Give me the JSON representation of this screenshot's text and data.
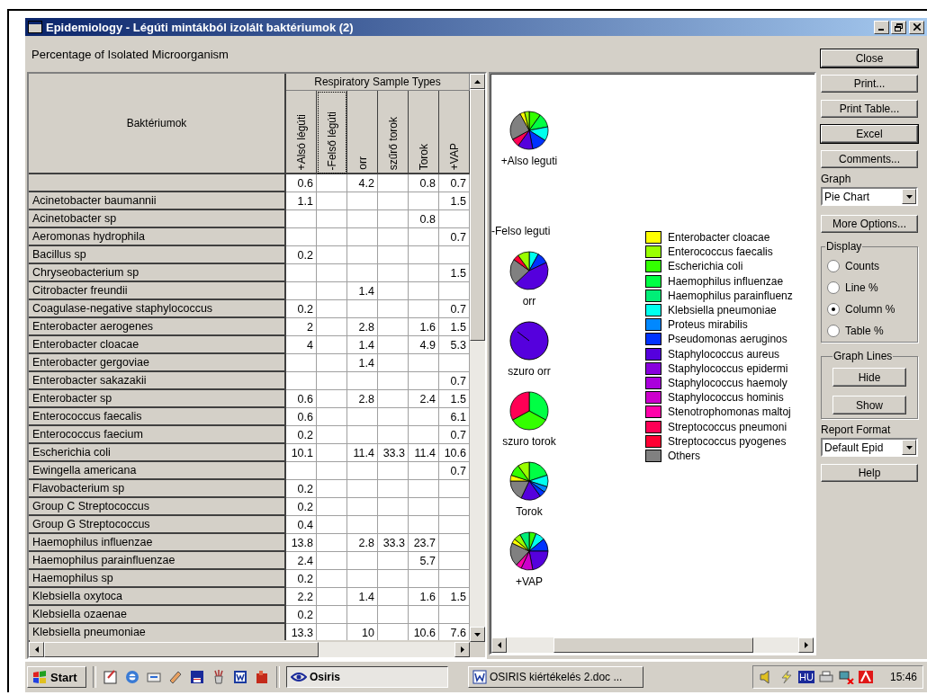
{
  "window": {
    "title": "Epidemiology - Légúti mintákból izolált baktériumok (2)",
    "subtitle": "Percentage of Isolated Microorganism"
  },
  "table": {
    "row_header": "Baktériumok",
    "group_header": "Respiratory Sample Types",
    "columns": [
      {
        "label": "+Alsó légúti",
        "focused": false
      },
      {
        "label": "-Felső légúti",
        "focused": true
      },
      {
        "label": "orr",
        "focused": false
      },
      {
        "label": "szűrő torok",
        "focused": false
      },
      {
        "label": "Torok",
        "focused": false
      },
      {
        "label": "+VAP",
        "focused": false
      }
    ],
    "rows": [
      {
        "col_1": "0.6",
        "col_3": "4.2",
        "col_5": "0.8",
        "col_6": "0.7"
      },
      {
        "name": "Acinetobacter baumannii",
        "col_1": "1.1",
        "col_6": "1.5"
      },
      {
        "name": "Acinetobacter sp",
        "col_5": "0.8"
      },
      {
        "name": "Aeromonas hydrophila",
        "col_6": "0.7"
      },
      {
        "name": "Bacillus sp",
        "col_1": "0.2"
      },
      {
        "name": "Chryseobacterium sp",
        "col_6": "1.5"
      },
      {
        "name": "Citrobacter freundii",
        "col_3": "1.4"
      },
      {
        "name": "Coagulase-negative staphylococcus",
        "col_1": "0.2",
        "col_6": "0.7"
      },
      {
        "name": "Enterobacter aerogenes",
        "col_1": "2",
        "col_3": "2.8",
        "col_5": "1.6",
        "col_6": "1.5"
      },
      {
        "name": "Enterobacter cloacae",
        "col_1": "4",
        "col_3": "1.4",
        "col_5": "4.9",
        "col_6": "5.3"
      },
      {
        "name": "Enterobacter gergoviae",
        "col_3": "1.4"
      },
      {
        "name": "Enterobacter sakazakii",
        "col_6": "0.7"
      },
      {
        "name": "Enterobacter sp",
        "col_1": "0.6",
        "col_3": "2.8",
        "col_5": "2.4",
        "col_6": "1.5"
      },
      {
        "name": "Enterococcus faecalis",
        "col_1": "0.6",
        "col_6": "6.1"
      },
      {
        "name": "Enterococcus faecium",
        "col_1": "0.2",
        "col_6": "0.7"
      },
      {
        "name": "Escherichia coli",
        "col_1": "10.1",
        "col_3": "11.4",
        "col_4": "33.3",
        "col_5": "11.4",
        "col_6": "10.6"
      },
      {
        "name": "Ewingella americana",
        "col_6": "0.7"
      },
      {
        "name": "Flavobacterium sp",
        "col_1": "0.2"
      },
      {
        "name": "Group C Streptococcus",
        "col_1": "0.2"
      },
      {
        "name": "Group G Streptococcus",
        "col_1": "0.4"
      },
      {
        "name": "Haemophilus influenzae",
        "col_1": "13.8",
        "col_3": "2.8",
        "col_4": "33.3",
        "col_5": "23.7"
      },
      {
        "name": "Haemophilus parainfluenzae",
        "col_1": "2.4",
        "col_5": "5.7"
      },
      {
        "name": "Haemophilus sp",
        "col_1": "0.2"
      },
      {
        "name": "Klebsiella oxytoca",
        "col_1": "2.2",
        "col_3": "1.4",
        "col_5": "1.6",
        "col_6": "1.5"
      },
      {
        "name": "Klebsiella ozaenae",
        "col_1": "0.2"
      },
      {
        "name": "Klebsiella pneumoniae",
        "col_1": "13.3",
        "col_3": "10",
        "col_5": "10.6",
        "col_6": "7.6"
      }
    ]
  },
  "pies": [
    {
      "label": "+Also leguti",
      "kind": "pie"
    },
    {
      "label": "-Felso leguti",
      "kind": "none"
    },
    {
      "label": "orr",
      "kind": "pie"
    },
    {
      "label": "szuro orr",
      "kind": "pie"
    },
    {
      "label": "szuro torok",
      "kind": "pie"
    },
    {
      "label": "Torok",
      "kind": "pie"
    },
    {
      "label": "+VAP",
      "kind": "pie"
    }
  ],
  "legend": [
    {
      "label": "Enterobacter cloacae",
      "color": "#ffff00"
    },
    {
      "label": "Enterococcus faecalis",
      "color": "#99ff00"
    },
    {
      "label": "Escherichia coli",
      "color": "#33ff00"
    },
    {
      "label": "Haemophilus influenzae",
      "color": "#00ff44"
    },
    {
      "label": "Haemophilus parainfluenz",
      "color": "#00ee77"
    },
    {
      "label": "Klebsiella pneumoniae",
      "color": "#00ffee"
    },
    {
      "label": "Proteus mirabilis",
      "color": "#0088ff"
    },
    {
      "label": "Pseudomonas aeruginos",
      "color": "#0033ff"
    },
    {
      "label": "Staphylococcus aureus",
      "color": "#5500dd"
    },
    {
      "label": "Staphylococcus epidermi",
      "color": "#8800dd"
    },
    {
      "label": "Staphylococcus haemoly",
      "color": "#aa00dd"
    },
    {
      "label": "Staphylococcus hominis",
      "color": "#cc00cc"
    },
    {
      "label": "Stenotrophomonas maltoj",
      "color": "#ff00aa"
    },
    {
      "label": "Streptococcus pneumoni",
      "color": "#ff0055"
    },
    {
      "label": "Streptococcus pyogenes",
      "color": "#ff0033"
    },
    {
      "label": "Others",
      "color": "#808080"
    }
  ],
  "actions": [
    {
      "label": "Close",
      "default": true
    },
    {
      "label": "Print...",
      "default": false
    },
    {
      "label": "Print Table...",
      "default": false
    },
    {
      "label": "Excel",
      "default": true
    },
    {
      "label": "Comments...",
      "default": false
    }
  ],
  "graph": {
    "label": "Graph",
    "value": "Pie Chart"
  },
  "more_options": "More Options...",
  "display": {
    "label": "Display",
    "options": [
      {
        "label": "Counts",
        "selected": false
      },
      {
        "label": "Line %",
        "selected": false
      },
      {
        "label": "Column %",
        "selected": true
      },
      {
        "label": "Table %",
        "selected": false
      }
    ]
  },
  "graph_lines": {
    "label": "Graph Lines",
    "buttons": [
      "Hide",
      "Show"
    ]
  },
  "report_format": {
    "label": "Report Format",
    "value": "Default Epid"
  },
  "help": "Help",
  "taskbar": {
    "start": "Start",
    "tasks": [
      {
        "label": "Osiris",
        "selected": true
      },
      {
        "label": "OSIRIS kiértékelés 2.doc ...",
        "selected": false
      }
    ],
    "language": "HU",
    "clock": "15:46"
  }
}
